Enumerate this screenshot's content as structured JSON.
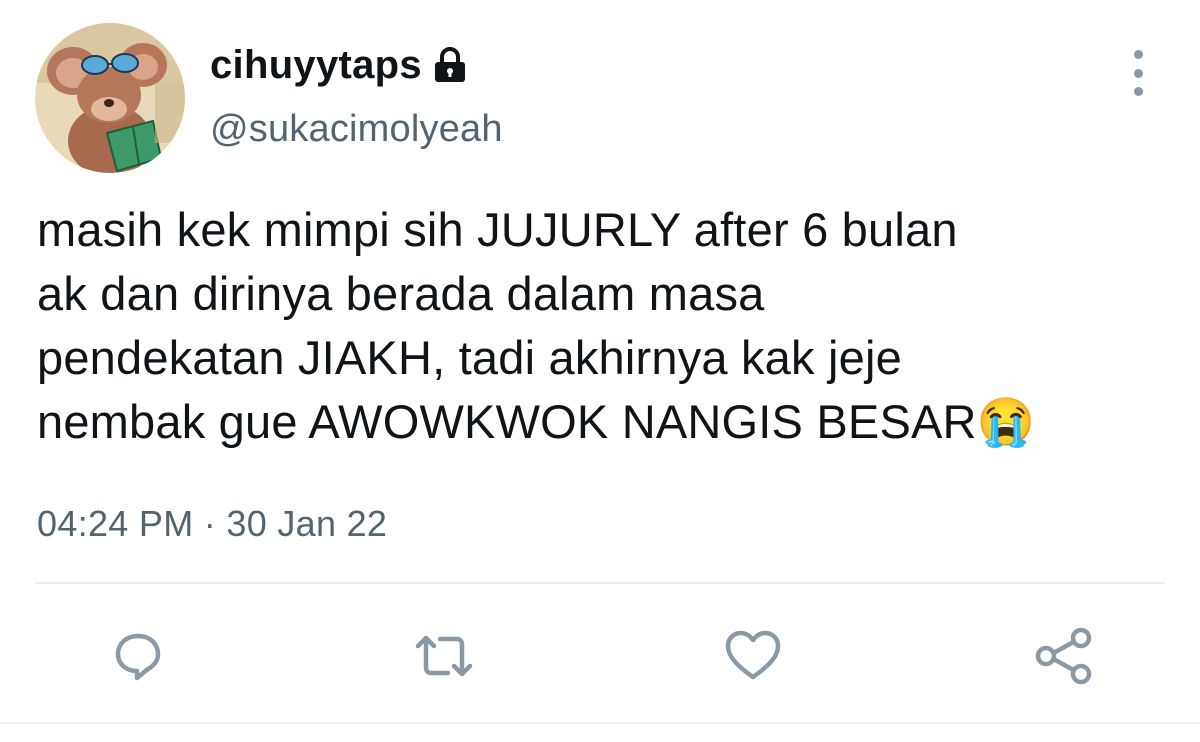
{
  "user": {
    "display_name": "cihuyytaps",
    "handle": "@sukacimolyeah",
    "protected_icon": "lock-icon",
    "avatar_icon": "cartoon-mouse-avatar"
  },
  "tweet": {
    "text": "masih kek mimpi sih JUJURLY after 6 bulan\nak dan dirinya berada dalam masa\npendekatan JIAKH, tadi akhirnya kak jeje\nnembak gue AWOWKWOK NANGIS BESAR😭",
    "timestamp": "04:24 PM · 30 Jan 22"
  },
  "actions": [
    {
      "name": "reply",
      "icon": "reply-icon"
    },
    {
      "name": "retweet",
      "icon": "retweet-icon"
    },
    {
      "name": "like",
      "icon": "heart-icon"
    },
    {
      "name": "share",
      "icon": "share-icon"
    }
  ],
  "colors": {
    "primary_text": "#0f1419",
    "secondary_text": "#536471",
    "icon_gray": "#8b98a5",
    "divider": "#e6ecf0"
  }
}
